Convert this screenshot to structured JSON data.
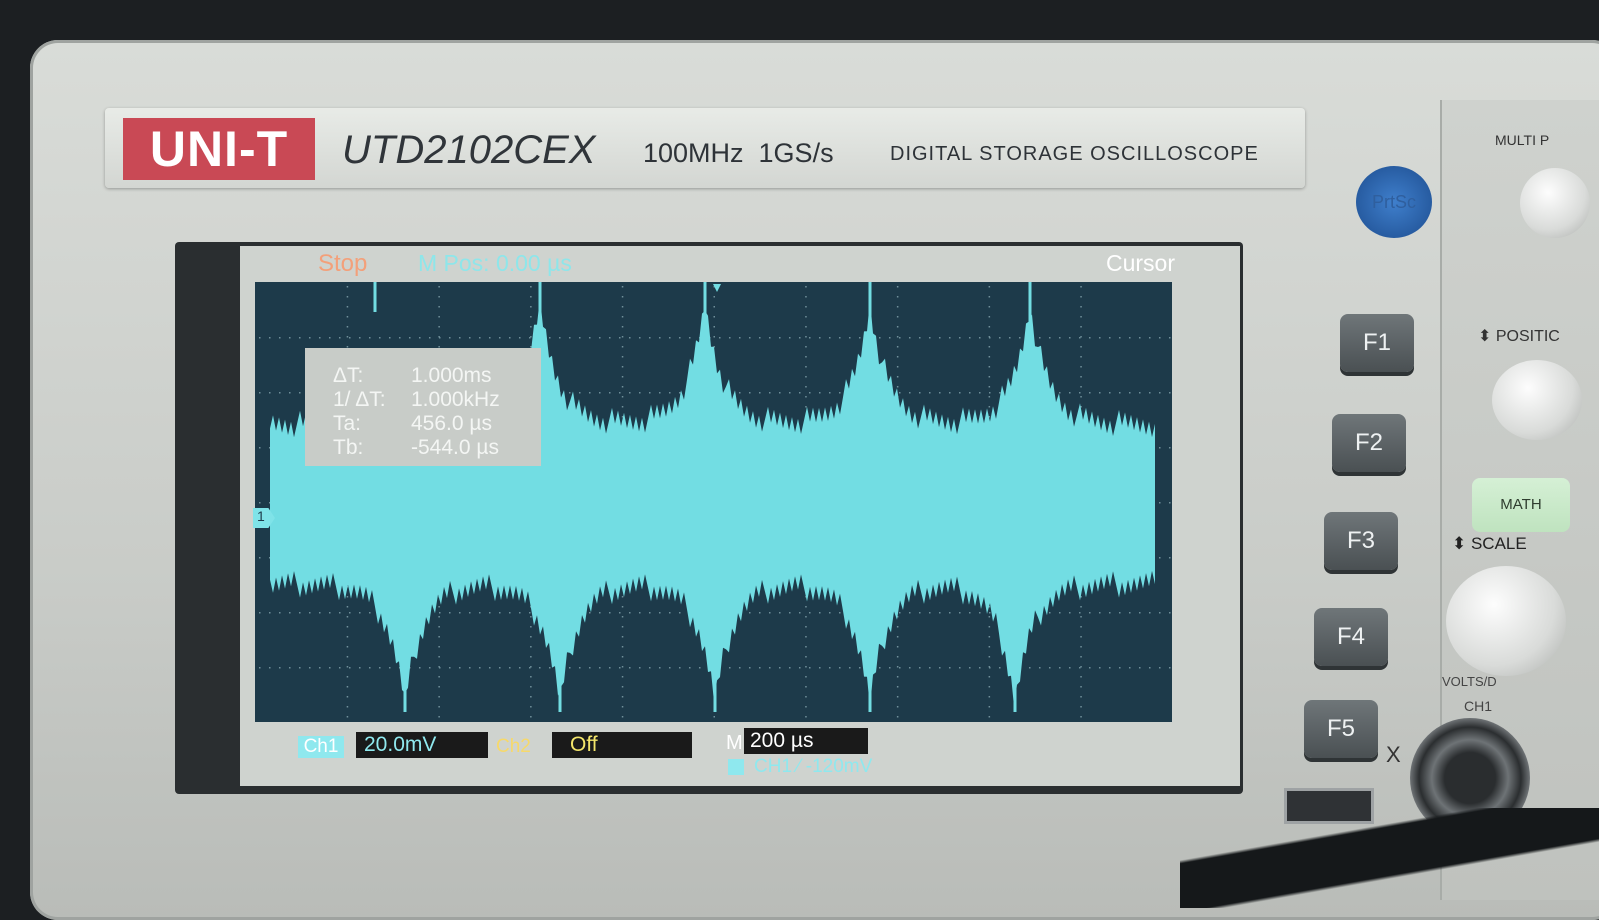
{
  "brand": {
    "logo": "UNI-T",
    "model": "UTD2102CEX",
    "spec": "100MHz  1GS/s",
    "description": "DIGITAL STORAGE OSCILLOSCOPE"
  },
  "status": {
    "run_state": "Stop",
    "m_pos": "M Pos: 0.00 µs",
    "menu": "Cursor"
  },
  "cursor_readout": {
    "rows": [
      {
        "label": "ΔT:",
        "value": "1.000ms"
      },
      {
        "label": "1/ ΔT:",
        "value": "1.000kHz"
      },
      {
        "label": "Ta:",
        "value": "456.0 µs"
      },
      {
        "label": "Tb:",
        "value": "-544.0 µs"
      }
    ]
  },
  "channel_marker": "1",
  "bottom": {
    "ch1_label": "Ch1",
    "ch1_scale": "20.0mV",
    "ch2_label": "Ch2",
    "ch2_state": "Off",
    "timebase_prefix": "M",
    "timebase": "200 µs",
    "trigger": "CH1 ⁄  -120mV"
  },
  "buttons": {
    "printsc": "PrtSc",
    "f1": "F1",
    "f2": "F2",
    "f3": "F3",
    "f4": "F4",
    "f5": "F5"
  },
  "panel": {
    "multi": "MULTI P",
    "position": "⬍ POSITIC",
    "math": "MATH",
    "scale": "⬍ SCALE",
    "volts": "VOLTS/D",
    "ch1": "CH1",
    "x": "X"
  },
  "colors": {
    "waveform": "#72dde3",
    "plot_bg": "#1d3a4a",
    "grid": "#6f8f99"
  }
}
